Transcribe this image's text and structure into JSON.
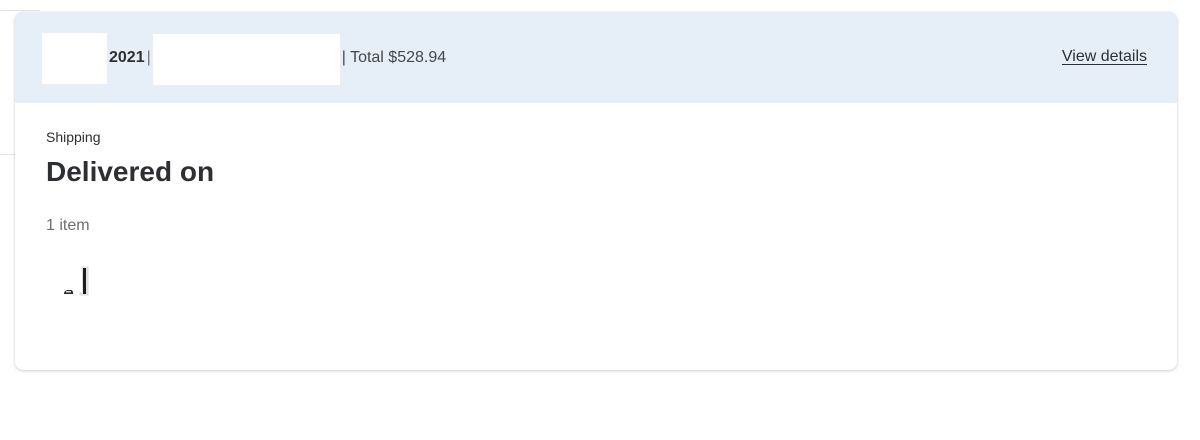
{
  "order": {
    "year": "2021",
    "separator": "|",
    "total_text": "| Total $528.94",
    "view_details_label": "View details"
  },
  "fulfillment": {
    "type": "Shipping",
    "status": "Delivered on",
    "item_count": "1 item"
  },
  "items": [
    {
      "icon": "game-console-icon"
    }
  ],
  "colors": {
    "header_bg": "#e6eef8",
    "card_bg": "#ffffff",
    "text_primary": "#2e2f32",
    "text_secondary": "#6d6e71"
  }
}
